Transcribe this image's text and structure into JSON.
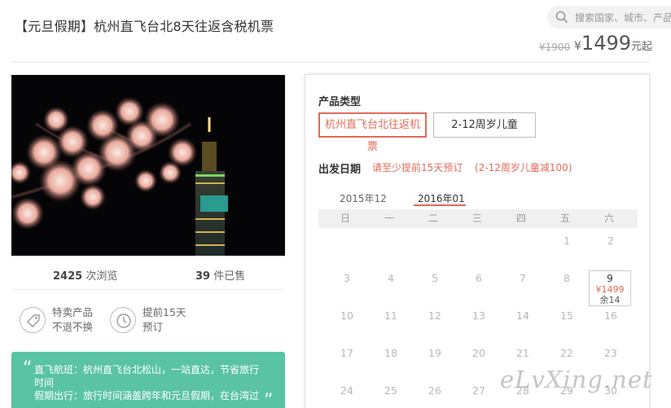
{
  "header": {
    "title": "【元旦假期】杭州直飞台北8天往返含税机票",
    "search_placeholder": "搜索国家、城市、产品"
  },
  "price": {
    "original": "¥1900",
    "currency": "¥",
    "current": "1499",
    "unit": "元起"
  },
  "stats": {
    "views_count": "2425",
    "views_label": "次浏览",
    "sold_count": "39",
    "sold_label": "件已售"
  },
  "features": [
    {
      "icon": "tag-icon",
      "line1": "特卖产品",
      "line2": "不退不换"
    },
    {
      "icon": "clock-icon",
      "line1": "提前15天",
      "line2": "预订"
    }
  ],
  "tips": {
    "line1": "直飞航班：杭州直飞台北松山，一站直达，节省旅行时间",
    "line2": "假期出行：旅行时间涵盖跨年和元旦假期，在台湾过"
  },
  "booking": {
    "type_label": "产品类型",
    "options": [
      "杭州直飞台北往返机票",
      "2-12周岁儿童"
    ],
    "date_label": "出发日期",
    "note_advance": "请至少提前15天预订",
    "note_child": "(2-12周岁儿童减100)",
    "months": [
      "2015年12",
      "2016年01"
    ],
    "weekdays": [
      "日",
      "一",
      "二",
      "三",
      "四",
      "五",
      "六"
    ],
    "weeks": [
      [
        "",
        "",
        "",
        "",
        "",
        "1",
        "2"
      ],
      [
        "3",
        "4",
        "5",
        "6",
        "7",
        "8",
        "9"
      ],
      [
        "10",
        "11",
        "12",
        "13",
        "14",
        "15",
        "16"
      ],
      [
        "17",
        "18",
        "19",
        "20",
        "21",
        "22",
        "23"
      ],
      [
        "24",
        "25",
        "26",
        "27",
        "28",
        "29",
        "30"
      ]
    ],
    "selected_day": {
      "day": "9",
      "price": "¥1499",
      "remaining": "余14"
    }
  },
  "watermark": "eLvXing.net",
  "colors": {
    "accent": "#e06a5b",
    "tip_bg": "#5ac4a2"
  }
}
